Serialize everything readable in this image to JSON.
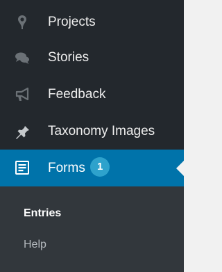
{
  "menu": {
    "projects": {
      "label": "Projects",
      "icon": "map-pin-icon"
    },
    "stories": {
      "label": "Stories",
      "icon": "chat-bubbles-icon"
    },
    "feedback": {
      "label": "Feedback",
      "icon": "megaphone-icon"
    },
    "taxonomy": {
      "label": "Taxonomy Images",
      "icon": "pushpin-icon"
    },
    "forms": {
      "label": "Forms",
      "badge": "1",
      "icon": "form-icon",
      "active": true
    }
  },
  "submenu": {
    "entries": {
      "label": "Entries",
      "current": true
    },
    "help": {
      "label": "Help"
    }
  },
  "colors": {
    "sidebar_bg": "#23282d",
    "active_bg": "#0073aa",
    "submenu_bg": "#32373c",
    "badge_bg": "#2ea2cc",
    "page_bg": "#f1f1f1"
  }
}
